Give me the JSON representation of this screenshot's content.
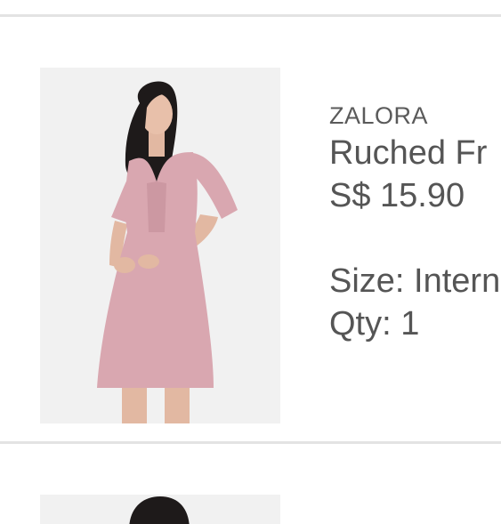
{
  "cart": {
    "items": [
      {
        "brand": "ZALORA",
        "name": "Ruched Fr",
        "price": "S$ 15.90",
        "size_label": "Size: Intern",
        "qty_label": "Qty: 1",
        "image_description": "pink-dress-product-photo"
      }
    ]
  },
  "colors": {
    "divider": "#e3e3e3",
    "image_background": "#f1f1f1",
    "text": "#555555",
    "dress": "#d9a7b0"
  }
}
